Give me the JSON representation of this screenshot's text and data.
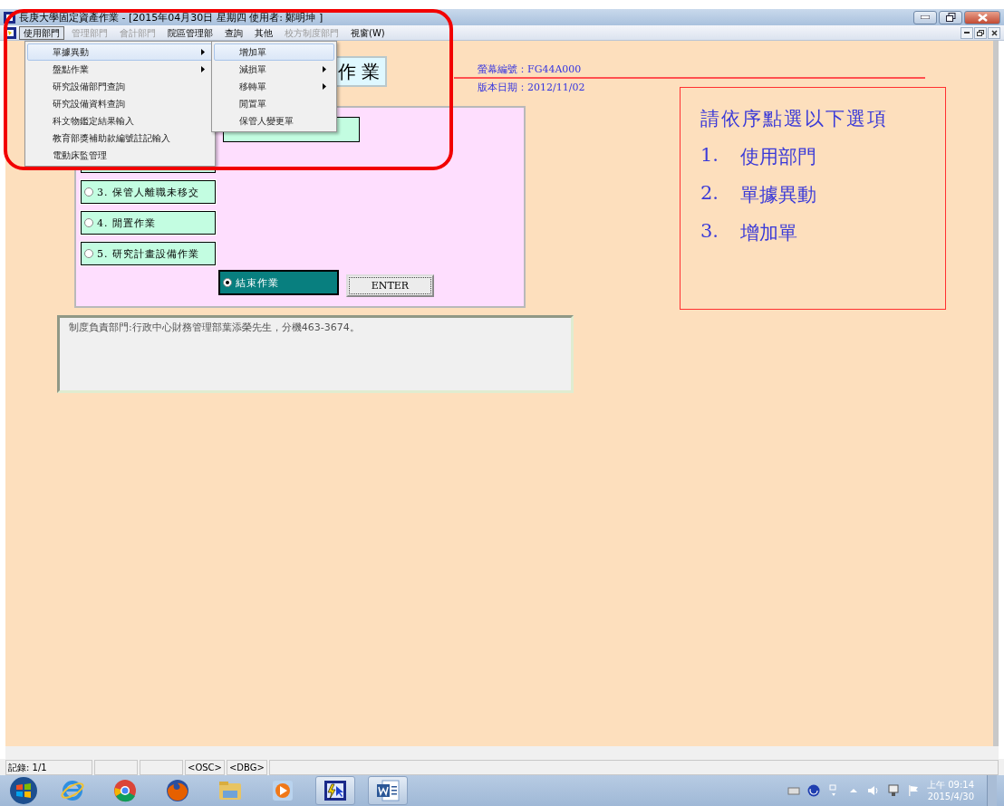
{
  "window": {
    "title": "長庚大學固定資產作業 - [2015年04月30日 星期四  使用者: 鄭明坤 ]"
  },
  "menubar": [
    {
      "label": "使用部門",
      "disabled": false,
      "selected": true
    },
    {
      "label": "管理部門",
      "disabled": true,
      "selected": false
    },
    {
      "label": "會計部門",
      "disabled": true,
      "selected": false
    },
    {
      "label": "院區管理部",
      "disabled": false,
      "selected": false
    },
    {
      "label": "查詢",
      "disabled": false,
      "selected": false
    },
    {
      "label": "其他",
      "disabled": false,
      "selected": false
    },
    {
      "label": "校方制度部門",
      "disabled": true,
      "selected": false
    },
    {
      "label": "視窗(W)",
      "disabled": false,
      "selected": false
    }
  ],
  "dropdown": [
    {
      "label": "單據異動",
      "submenu": true,
      "selected": true
    },
    {
      "label": "盤點作業",
      "submenu": true,
      "selected": false
    },
    {
      "label": "研究設備部門查詢",
      "submenu": false,
      "selected": false
    },
    {
      "label": "研究設備資料查詢",
      "submenu": false,
      "selected": false
    },
    {
      "label": "科文物鑑定結果輸入",
      "submenu": false,
      "selected": false
    },
    {
      "label": "教育部獎補助款編號註記輸入",
      "submenu": false,
      "selected": false
    },
    {
      "label": "電動床監管理",
      "submenu": false,
      "selected": false
    }
  ],
  "submenu": [
    {
      "label": "增加單",
      "submenu": false,
      "selected": true
    },
    {
      "label": "減損單",
      "submenu": true,
      "selected": false
    },
    {
      "label": "移轉單",
      "submenu": true,
      "selected": false
    },
    {
      "label": "閒置單",
      "submenu": false,
      "selected": false
    },
    {
      "label": "保管人變更單",
      "submenu": false,
      "selected": false
    }
  ],
  "form": {
    "title": "作 業",
    "screen_no": "螢幕編號：FG44A000",
    "version_date": "版本日期：2012/11/02",
    "options": [
      {
        "label": "3. 保管人離職未移交",
        "selected": false
      },
      {
        "label": "4. 閒置作業",
        "selected": false
      },
      {
        "label": "5. 研究計畫設備作業",
        "selected": false
      },
      {
        "label": "結束作業",
        "selected": true
      }
    ],
    "enter_button": "ENTER",
    "note": "制度負責部門:行政中心財務管理部葉添榮先生，分機463-3674。"
  },
  "annotation": {
    "heading": "請依序點選以下選項",
    "steps": [
      {
        "number": "1.",
        "label": "使用部門"
      },
      {
        "number": "2.",
        "label": "單據異動"
      },
      {
        "number": "3.",
        "label": "增加單"
      }
    ]
  },
  "status_bar": {
    "panels": [
      "記錄: 1/1",
      "<OSC>",
      "<DBG>"
    ]
  },
  "taskbar": {
    "apps": [
      {
        "kind": "ie",
        "active": false
      },
      {
        "kind": "chrome",
        "active": false
      },
      {
        "kind": "firefox",
        "active": false
      },
      {
        "kind": "folder",
        "active": false
      },
      {
        "kind": "media",
        "active": false
      },
      {
        "kind": "app",
        "active": true
      },
      {
        "kind": "word",
        "active": true
      }
    ],
    "time": "上午 09:14",
    "date": "2015/4/30"
  }
}
